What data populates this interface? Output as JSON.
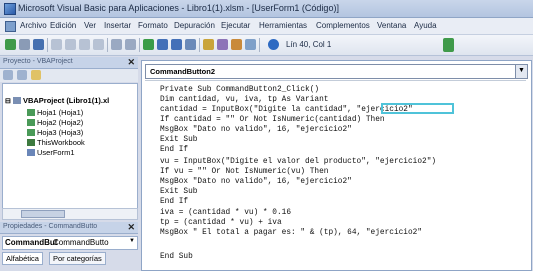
{
  "window": {
    "title": "Microsoft Visual Basic para Aplicaciones - Libro1(1).xlsm - [UserForm1 (Código)]"
  },
  "menu": {
    "items": [
      "Archivo",
      "Edición",
      "Ver",
      "Insertar",
      "Formato",
      "Depuración",
      "Ejecutar",
      "Herramientas",
      "Complementos",
      "Ventana",
      "Ayuda"
    ]
  },
  "toolbar": {
    "cursor_position": "Lín 40, Col 1"
  },
  "project_panel": {
    "title": "Proyecto - VBAProject",
    "tree": [
      {
        "label": "VBAProject (Libro1(1).xl"
      },
      {
        "label": "Hoja1 (Hoja1)"
      },
      {
        "label": "Hoja2 (Hoja2)"
      },
      {
        "label": "Hoja3 (Hoja3)"
      },
      {
        "label": "ThisWorkbook"
      },
      {
        "label": "UserForm1"
      }
    ]
  },
  "properties_panel": {
    "title": "Propiedades - CommandButto",
    "object_name": "CommandBut",
    "object_type": "CommandButto",
    "tabs": [
      "Alfabética",
      "Por categorías"
    ]
  },
  "code_window": {
    "object_combo": "CommandButton2",
    "lines": [
      "Private Sub CommandButton2_Click()",
      "Dim cantidad, vu, iva, tp As Variant",
      "cantidad = InputBox(\"Digite la cantidad\", \"ejercicio2\"",
      "If cantidad = \"\" Or Not IsNumeric(cantidad) Then",
      "MsgBox \"Dato no valido\", 16, \"ejercicio2\"",
      "Exit Sub",
      "End If",
      "vu = InputBox(\"Digite el valor del producto\", \"ejercicio2\")",
      "If vu = \"\" Or Not IsNumeric(vu) Then",
      "MsgBox \"Dato no valido\", 16, \"ejercicio2\"",
      "Exit Sub",
      "End If",
      "iva = (cantidad * vu) * 0.16",
      "tp = (cantidad * vu) + iva",
      "MsgBox \" El total a pagar es: \" & (tp), 64, \"ejercicio2\"",
      "",
      "End Sub"
    ]
  }
}
